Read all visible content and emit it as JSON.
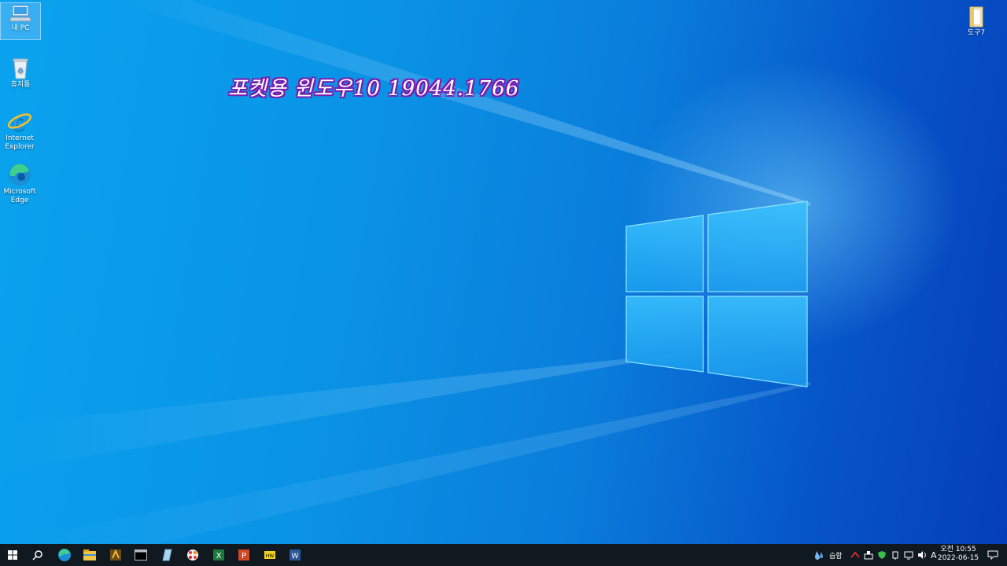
{
  "desktop": {
    "watermark": "포켓용 윈도우10 19044.1766",
    "icons": [
      {
        "name": "pc-icon",
        "label": "내 PC"
      },
      {
        "name": "recycle-bin-icon",
        "label": "휴지통"
      },
      {
        "name": "internet-explorer-icon",
        "label": "Internet Explorer"
      },
      {
        "name": "microsoft-edge-icon",
        "label": "Microsoft Edge"
      },
      {
        "name": "folder-icon",
        "label": "도구7"
      }
    ]
  },
  "taskbar": {
    "pinned": [
      "start-icon",
      "search-icon",
      "edge-icon",
      "file-explorer-icon",
      "app-icon",
      "terminal-icon",
      "notepad-icon",
      "paint-icon",
      "excel-icon",
      "powerpoint-icon",
      "hwp-icon",
      "word-icon"
    ],
    "tray": {
      "weather_text": "습함",
      "ime_text": "A",
      "time": "오전 10:55",
      "date": "2022-06-15"
    }
  },
  "colors": {
    "accent": "#0a93e6",
    "taskbar": "#101820"
  }
}
